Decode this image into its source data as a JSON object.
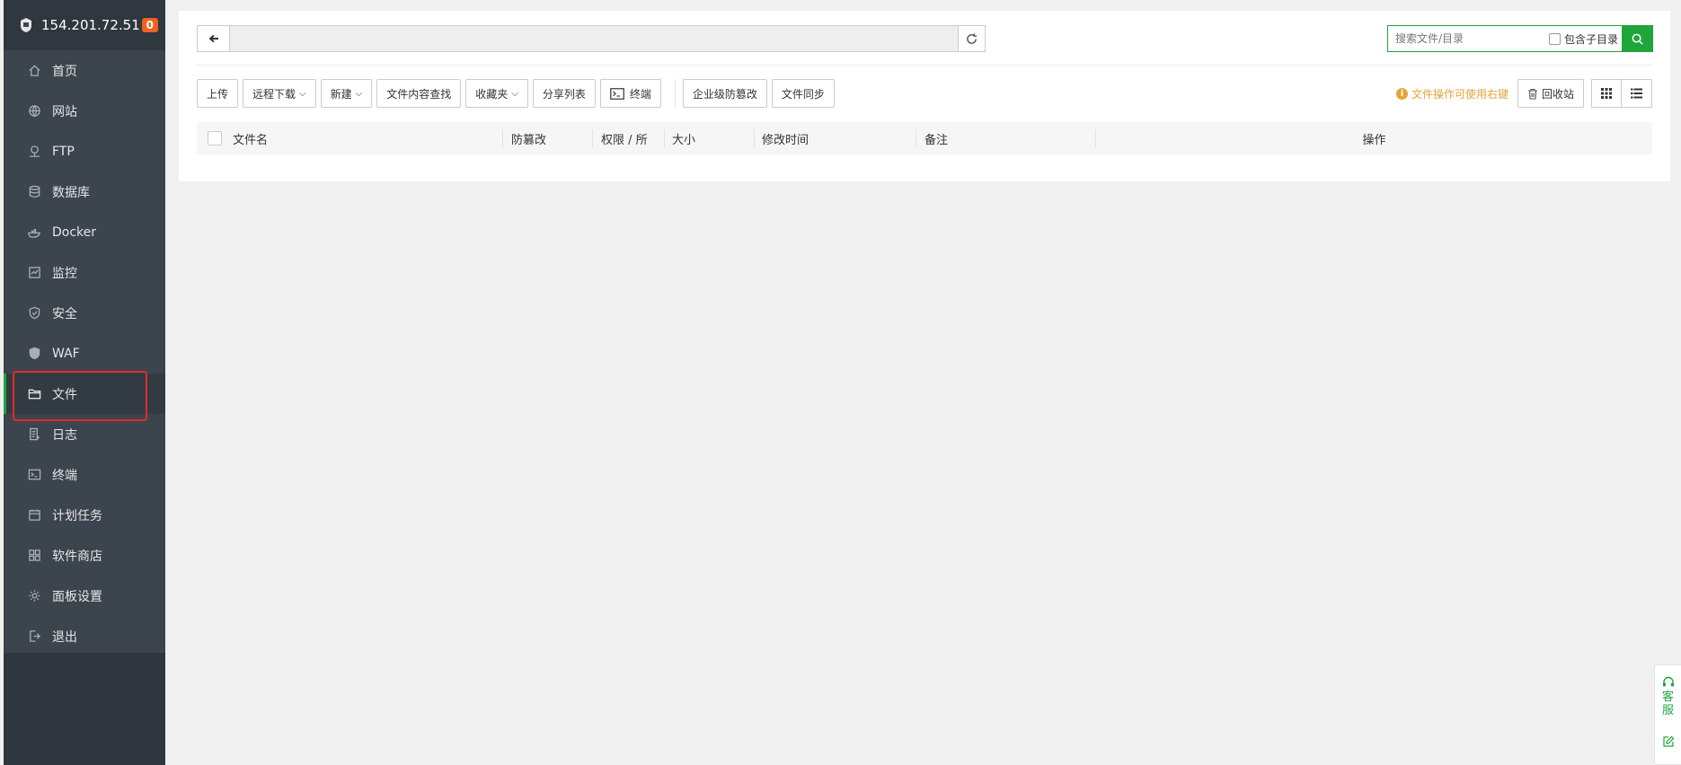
{
  "server": {
    "ip": "154.201.72.51",
    "badge": "0"
  },
  "menu": [
    {
      "label": "首页",
      "icon": "home-icon"
    },
    {
      "label": "网站",
      "icon": "globe-icon"
    },
    {
      "label": "FTP",
      "icon": "ftp-icon"
    },
    {
      "label": "数据库",
      "icon": "database-icon"
    },
    {
      "label": "Docker",
      "icon": "docker-icon"
    },
    {
      "label": "监控",
      "icon": "monitor-icon"
    },
    {
      "label": "安全",
      "icon": "shield-icon"
    },
    {
      "label": "WAF",
      "icon": "waf-icon"
    },
    {
      "label": "文件",
      "icon": "folder-icon",
      "active": true
    },
    {
      "label": "日志",
      "icon": "log-icon"
    },
    {
      "label": "终端",
      "icon": "terminal-icon"
    },
    {
      "label": "计划任务",
      "icon": "calendar-icon"
    },
    {
      "label": "软件商店",
      "icon": "apps-icon"
    },
    {
      "label": "面板设置",
      "icon": "gear-icon"
    },
    {
      "label": "退出",
      "icon": "logout-icon"
    }
  ],
  "search": {
    "placeholder": "搜索文件/目录",
    "subdir_label": "包含子目录"
  },
  "toolbar": {
    "upload": "上传",
    "remote_download": "远程下载",
    "new": "新建",
    "content_search": "文件内容查找",
    "favorites": "收藏夹",
    "share_list": "分享列表",
    "terminal": "终端",
    "tamper_proof": "企业级防篡改",
    "file_sync": "文件同步",
    "tip": "文件操作可使用右键",
    "recycle_bin": "回收站"
  },
  "table": {
    "columns": [
      "文件名",
      "防篡改",
      "权限 / 所",
      "大小",
      "修改时间",
      "备注",
      "操作"
    ]
  },
  "service": {
    "label": "客服"
  },
  "colors": {
    "accent": "#20a53a",
    "sidebar": "#3c444d",
    "warning": "#e5a33a",
    "highlight": "#e52929"
  }
}
